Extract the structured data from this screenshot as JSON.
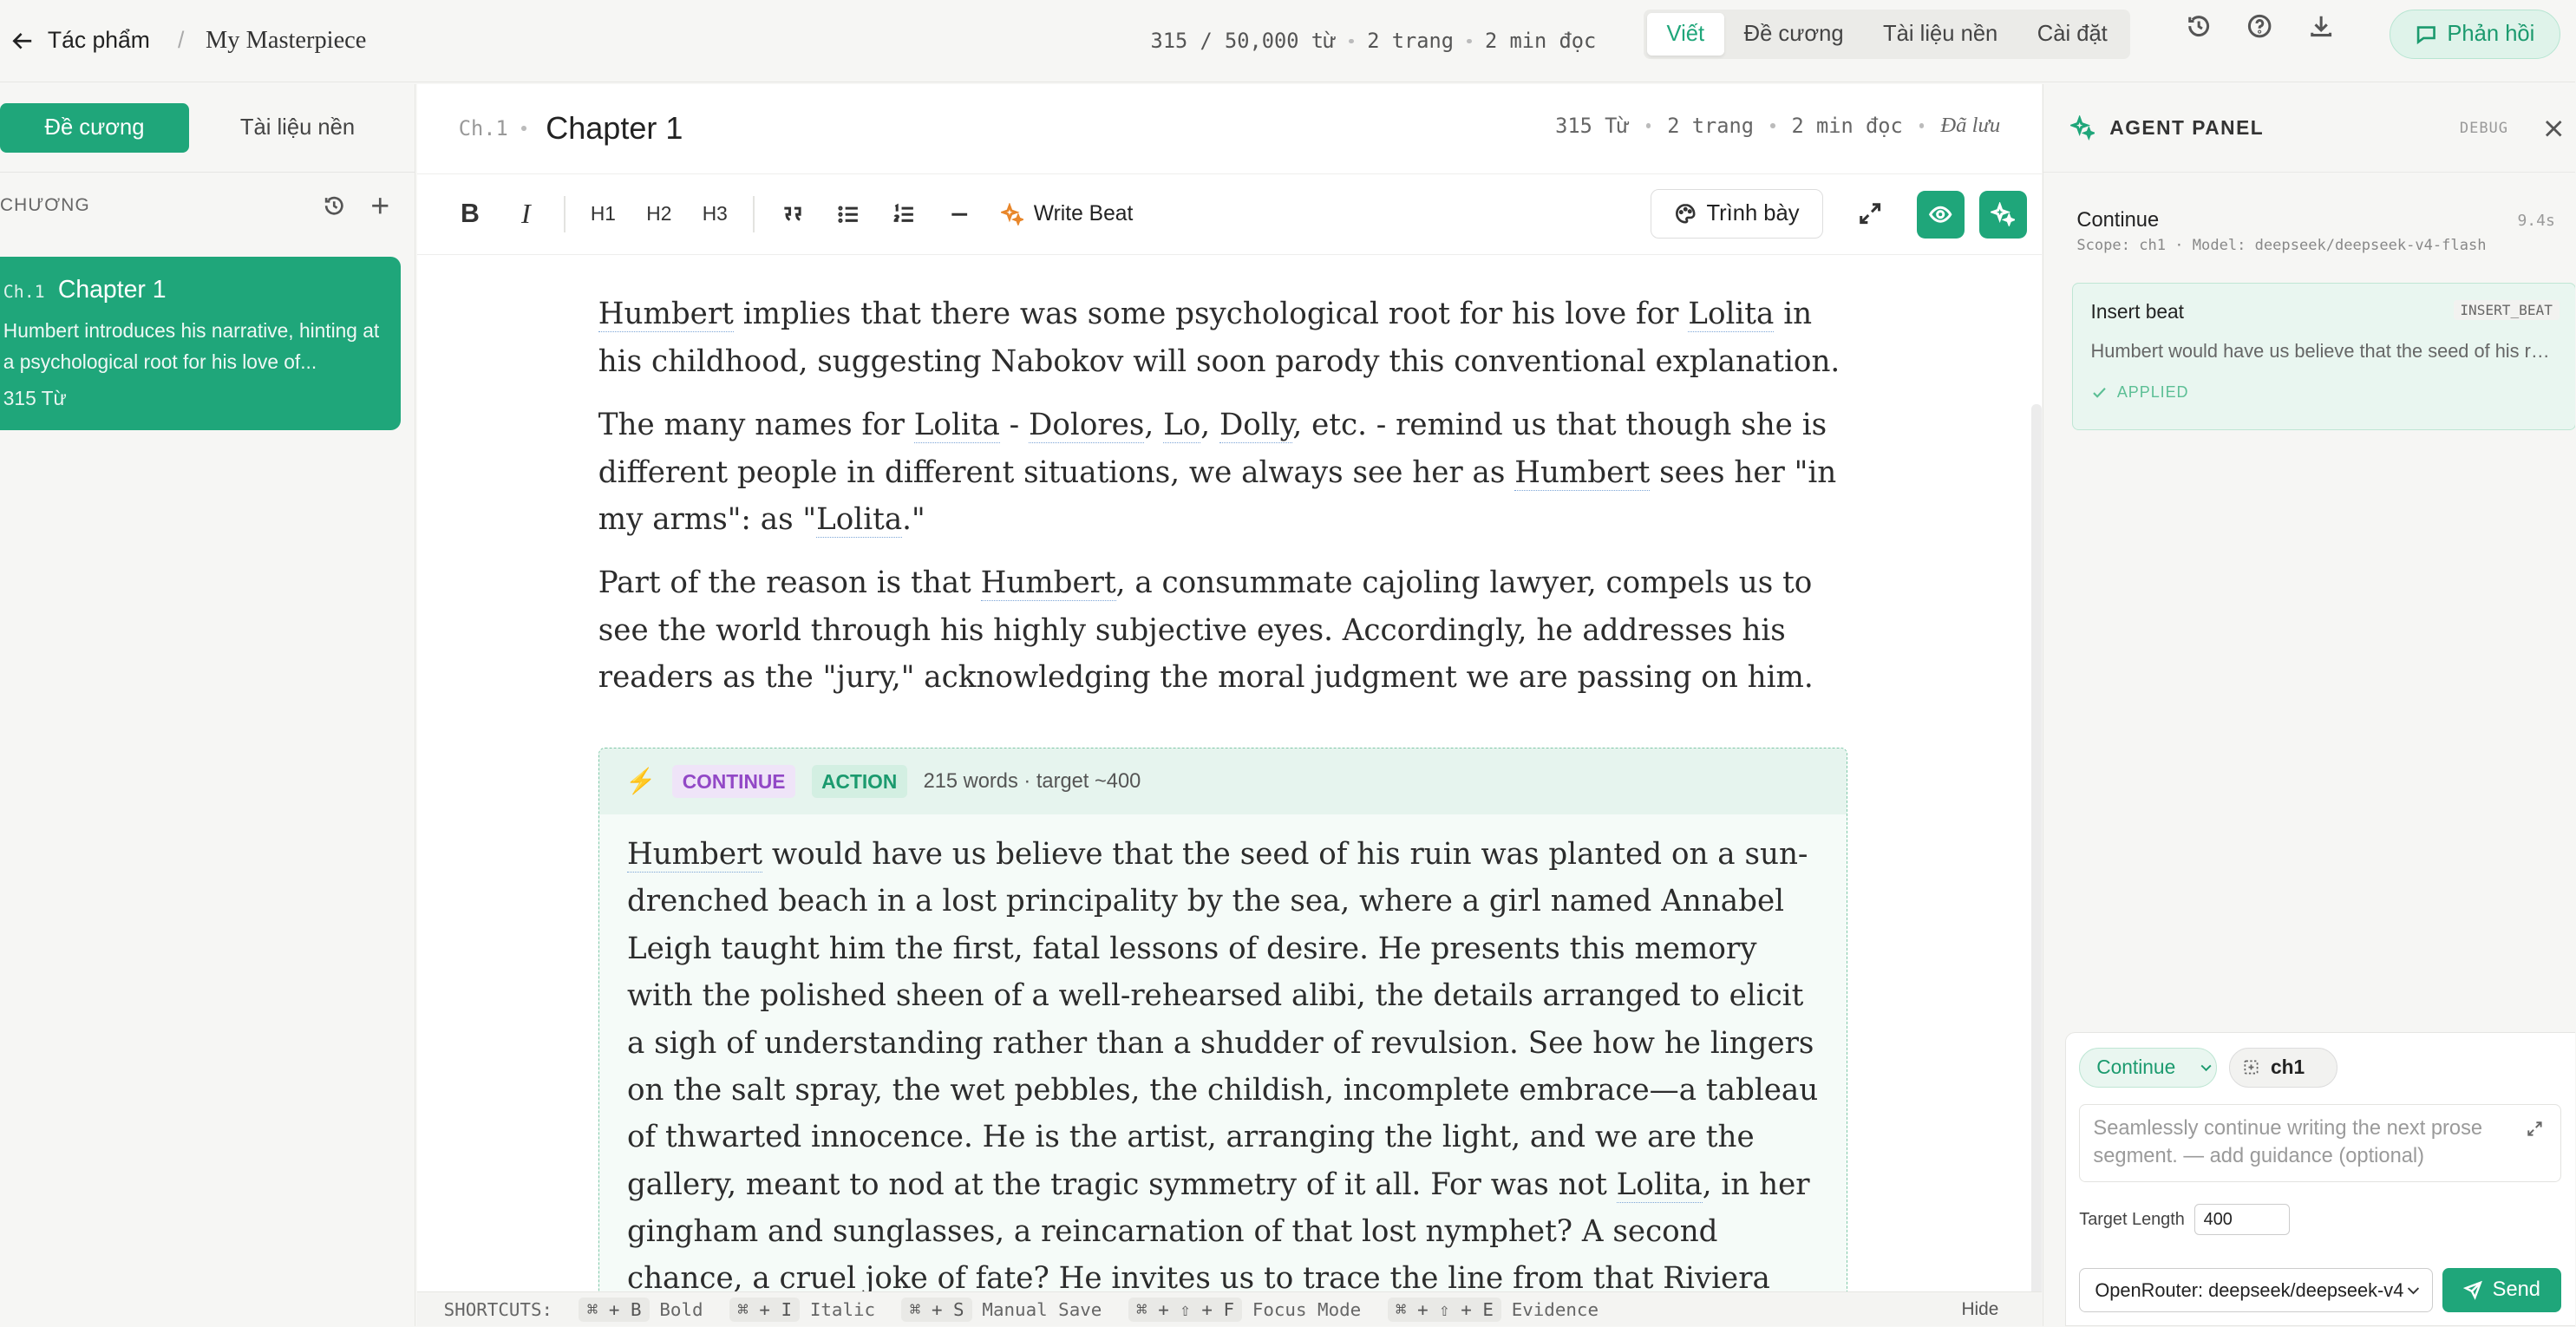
{
  "topbar": {
    "back_label": "Tác phẩm",
    "separator": "/",
    "project_title": "My Masterpiece",
    "word_count": "315 / 50,000 từ",
    "pages": "2 trang",
    "read_time": "2 min đọc",
    "modes": [
      "Viết",
      "Đề cương",
      "Tài liệu nền",
      "Cài đặt"
    ],
    "active_mode": "Viết",
    "feedback_label": "Phản hồi"
  },
  "sidebar": {
    "tabs": [
      "Đề cương",
      "Tài liệu nền"
    ],
    "section_label": "CHƯƠNG",
    "chapters": [
      {
        "num": "Ch.1",
        "title": "Chapter 1",
        "summary": "Humbert introduces his narrative, hinting at a psychological root for his love of...",
        "word_count": "315 Từ"
      }
    ]
  },
  "editor": {
    "chapter_num": "Ch.1",
    "chapter_title": "Chapter 1",
    "meta": {
      "words": "315 Từ",
      "pages": "2 trang",
      "read_time": "2 min đọc",
      "saved": "Đã lưu"
    },
    "toolbar": {
      "bold": "B",
      "italic": "I",
      "h1": "H1",
      "h2": "H2",
      "h3": "H3",
      "write_beat": "Write Beat",
      "present": "Trình bày"
    },
    "paragraphs": [
      [
        {
          "t": "Humbert",
          "n": true
        },
        {
          "t": " implies that there was some psychological root for his love for "
        },
        {
          "t": "Lolita",
          "n": true
        },
        {
          "t": " in his childhood, suggesting Nabokov will soon parody this conventional explanation."
        }
      ],
      [
        {
          "t": "The many names for "
        },
        {
          "t": "Lolita",
          "n": true
        },
        {
          "t": " - "
        },
        {
          "t": "Dolores",
          "n": true
        },
        {
          "t": ", "
        },
        {
          "t": "Lo",
          "n": true
        },
        {
          "t": ", "
        },
        {
          "t": "Dolly",
          "n": true
        },
        {
          "t": ", etc. - remind us that though she is different people in different situations, we always see her as "
        },
        {
          "t": "Humbert",
          "n": true
        },
        {
          "t": " sees her \"in my arms\": as \""
        },
        {
          "t": "Lolita",
          "n": true
        },
        {
          "t": ".\""
        }
      ],
      [
        {
          "t": "Part of the reason is that "
        },
        {
          "t": "Humbert",
          "n": true
        },
        {
          "t": ", a consummate cajoling lawyer, compels us to see the world through his highly subjective eyes. Accordingly, he addresses his readers as the \"jury,\" acknowledging the moral judgment we are passing on him."
        }
      ]
    ],
    "beat": {
      "bolt": "⚡",
      "type_label": "CONTINUE",
      "kind_label": "ACTION",
      "info": "215 words · target ~400",
      "text": [
        {
          "t": "Humbert",
          "n": true
        },
        {
          "t": " would have us believe that the seed of his ruin was planted on a sun-drenched beach in a lost principality by the sea, where a girl named Annabel Leigh taught him the first, fatal lessons of desire. He presents this memory with the polished sheen of a well-rehearsed alibi, the details arranged to elicit a sigh of understanding rather than a shudder of revulsion. See how he lingers on the salt spray, the wet pebbles, the childish, incomplete embrace—a tableau of thwarted innocence. He is the artist, arranging the light, and we are the gallery, meant to nod at the tragic symmetry of it all. For was not "
        },
        {
          "t": "Lolita",
          "n": true
        },
        {
          "t": ", in her gingham and sunglasses, a reincarnation of that lost nymphet? A second chance, a cruel joke of fate? He invites us to trace the line from that Riviera idyll to the Enchanted Hunters, to see his"
        }
      ]
    },
    "shortcuts": {
      "label": "SHORTCUTS:",
      "items": [
        {
          "key": "⌘ + B",
          "desc": "Bold"
        },
        {
          "key": "⌘ + I",
          "desc": "Italic"
        },
        {
          "key": "⌘ + S",
          "desc": "Manual Save"
        },
        {
          "key": "⌘ + ⇧ + F",
          "desc": "Focus Mode"
        },
        {
          "key": "⌘ + ⇧ + E",
          "desc": "Evidence"
        }
      ],
      "hide": "Hide"
    }
  },
  "agent": {
    "title": "AGENT PANEL",
    "debug": "DEBUG",
    "runs": [
      {
        "title": "Continue",
        "scope": "Scope: ch1 · Model: deepseek/deepseek-v4-flash",
        "duration": "9.4s"
      }
    ],
    "events": [
      {
        "title": "Insert beat",
        "tag": "INSERT_BEAT",
        "text": "Humbert would have us believe that the seed of his ruin was planted on a sun-drenched beach",
        "status": "APPLIED"
      }
    ],
    "composer": {
      "mode": "Continue",
      "scope": "ch1",
      "placeholder": "Seamlessly continue writing the next prose segment. — add guidance (optional)",
      "target_label": "Target Length",
      "target_value": "400",
      "model": "OpenRouter: deepseek/deepseek-v4",
      "send": "Send"
    }
  },
  "colors": {
    "accent": "#1fa67a",
    "accent_light": "#e9f6f0",
    "continue_purple": "#9248c6",
    "bolt": "#f0a022",
    "write_beat_icon": "#e8862a"
  }
}
